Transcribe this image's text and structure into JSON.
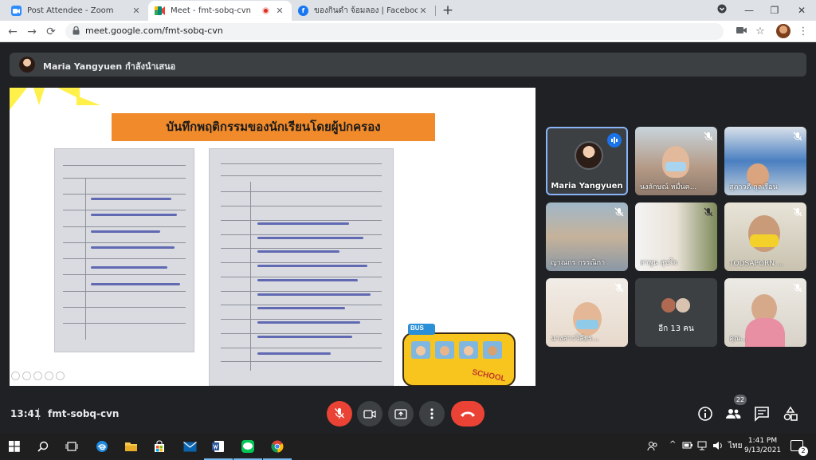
{
  "browser": {
    "tabs": [
      {
        "title": "Post Attendee - Zoom",
        "icon": "zoom-icon",
        "color": "#2d8cff"
      },
      {
        "title": "Meet - fmt-sobq-cvn",
        "icon": "meet-icon",
        "color": "#00897b",
        "active": true,
        "recording": true
      },
      {
        "title": "ของกินดำ จ้อมลอง | Facebook",
        "icon": "facebook-icon",
        "color": "#1877f2"
      }
    ],
    "new_tab": "+",
    "url": "meet.google.com/fmt-sobq-cvn",
    "window_controls": {
      "minimize": "—",
      "restore": "❐",
      "close": "✕"
    }
  },
  "meet": {
    "presenter_text": "Maria Yangyuen กำลังนำเสนอ",
    "slide": {
      "title": "บันทึกพฤติกรรมของนักเรียนโดยผู้ปกครอง",
      "bus_label": "BUS",
      "bus_text": "SCHOOL"
    },
    "participants": [
      {
        "name": "Maria Yangyuen",
        "speaking": true
      },
      {
        "name": "นงลักษณ์ หมื่นค...",
        "muted": true
      },
      {
        "name": "สุภาวดี กุลเรือน",
        "muted": true
      },
      {
        "name": "ญาณกร กรรณิกา",
        "muted": true
      },
      {
        "name": "สาพูน สุขใจ",
        "muted": true
      },
      {
        "name": "TODSAPORN ...",
        "muted": true
      },
      {
        "name": "นางสาววิลัยร...",
        "muted": true
      },
      {
        "name": "อีก 13 คน",
        "more": true
      },
      {
        "name": "คุณ...",
        "muted": true
      }
    ],
    "bottom": {
      "time": "13:41",
      "meeting_code": "fmt-sobq-cvn",
      "people_count": "22"
    }
  },
  "taskbar": {
    "apps": [
      "start-icon",
      "search-icon",
      "task-view-icon",
      "edge-icon",
      "file-explorer-icon",
      "store-icon",
      "mail-icon",
      "word-icon",
      "line-icon",
      "chrome-icon"
    ],
    "lang": "ไทย",
    "time": "1:41 PM",
    "date": "9/13/2021",
    "notifications": "2"
  },
  "colors": {
    "meet_bg": "#202124",
    "tile_bg": "#3c4043",
    "end_call": "#ea4335",
    "speaking_border": "#8ab4f8",
    "slide_title_bg": "#f08a2a"
  }
}
